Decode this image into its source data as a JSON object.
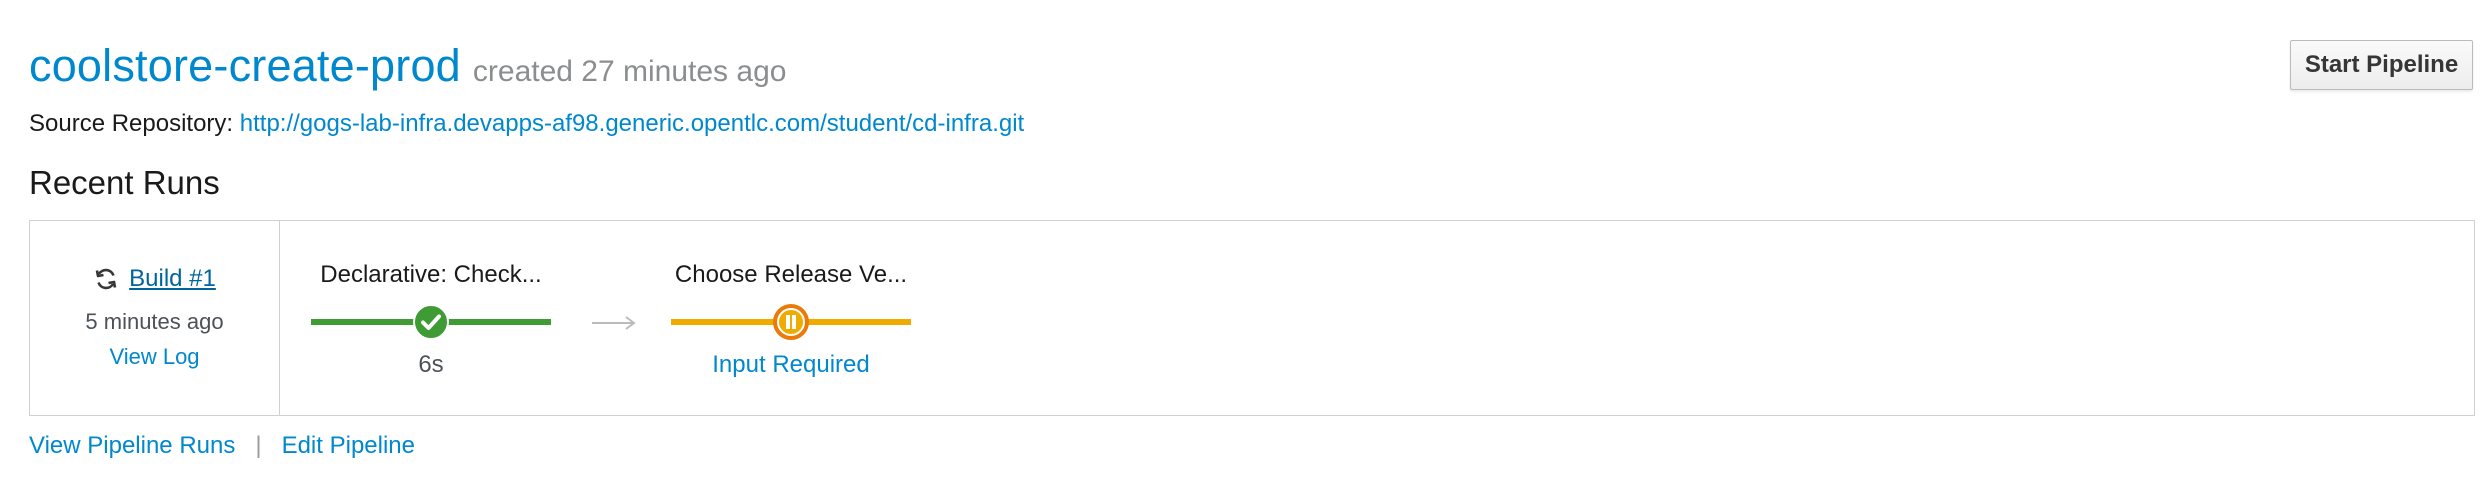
{
  "pipeline": {
    "name": "coolstore-create-prod",
    "created": "created 27 minutes ago",
    "start_label": "Start Pipeline"
  },
  "source": {
    "label": "Source Repository:",
    "url": "http://gogs-lab-infra.devapps-af98.generic.opentlc.com/student/cd-infra.git"
  },
  "recent_runs": {
    "title": "Recent Runs",
    "build": {
      "name": "Build #1",
      "icon": "sync-icon",
      "age": "5 minutes ago",
      "view_log": "View Log"
    },
    "stages": [
      {
        "name": "Declarative: Check...",
        "status": "complete",
        "icon": "check-icon",
        "color": "#3f9c35",
        "sub": "6s"
      },
      {
        "name": "Choose Release Ve...",
        "status": "paused",
        "icon": "pause-icon",
        "color": "#ec7a08",
        "bar_color": "#f0ab00",
        "sub": "Input Required",
        "sub_color": "#0088ce"
      }
    ]
  },
  "footer_links": {
    "view_runs": "View Pipeline Runs",
    "separator": "|",
    "edit": "Edit Pipeline"
  },
  "colors": {
    "link": "#0088ce",
    "border": "#d1d1d1",
    "arrow": "#bbbbbb"
  }
}
